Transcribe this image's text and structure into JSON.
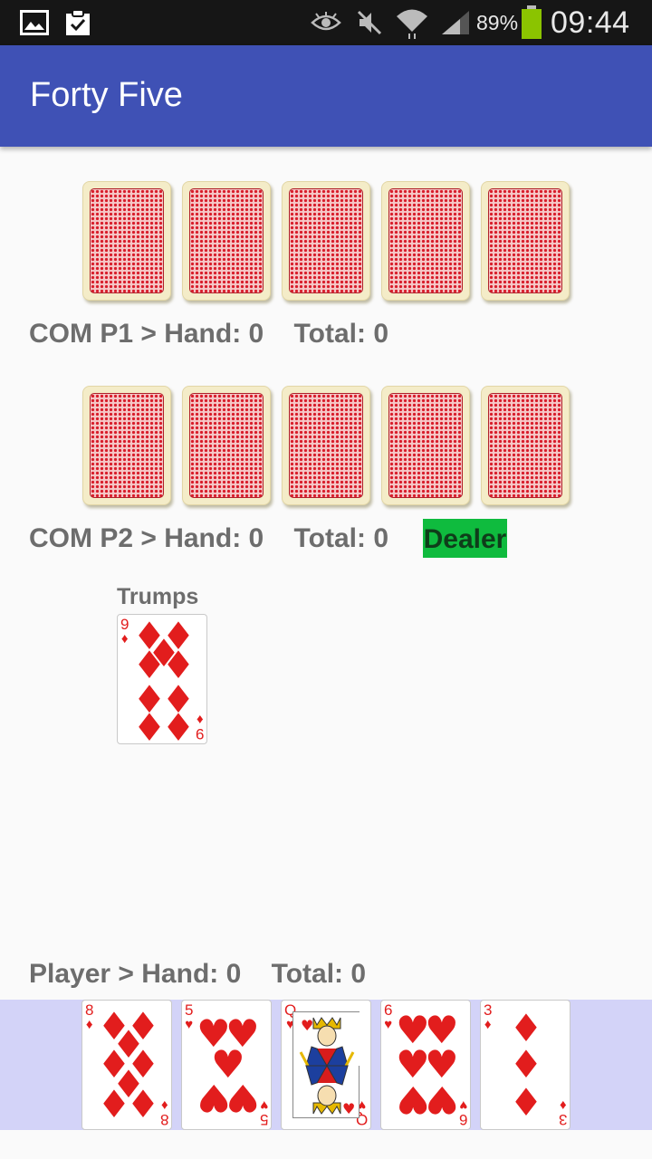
{
  "status_bar": {
    "battery_percent": "89%",
    "clock": "09:44",
    "icons": [
      "image-icon",
      "clipboard-check-icon",
      "eye-icon",
      "mute-icon",
      "wifi-icon",
      "signal-icon",
      "battery-icon"
    ],
    "battery_color": "#8bc400"
  },
  "app_bar": {
    "title": "Forty Five",
    "color": "#3f51b5"
  },
  "com_p1": {
    "hand_count": 5,
    "info": "COM P1 > Hand: 0    Total: 0"
  },
  "com_p2": {
    "hand_count": 5,
    "info": "COM P2 > Hand: 0    Total: 0",
    "dealer_label": "Dealer",
    "dealer_color": "#0fbb3e"
  },
  "trumps": {
    "label": "Trumps",
    "card": {
      "rank": "9",
      "suit": "♦"
    }
  },
  "player": {
    "info": "Player > Hand: 0    Total: 0",
    "hand": [
      {
        "rank": "8",
        "suit": "♦"
      },
      {
        "rank": "5",
        "suit": "♥"
      },
      {
        "rank": "Q",
        "suit": "♥"
      },
      {
        "rank": "6",
        "suit": "♥"
      },
      {
        "rank": "3",
        "suit": "♦"
      }
    ],
    "hand_background": "#d3d3f8"
  },
  "suit_color": "#e21d1d"
}
